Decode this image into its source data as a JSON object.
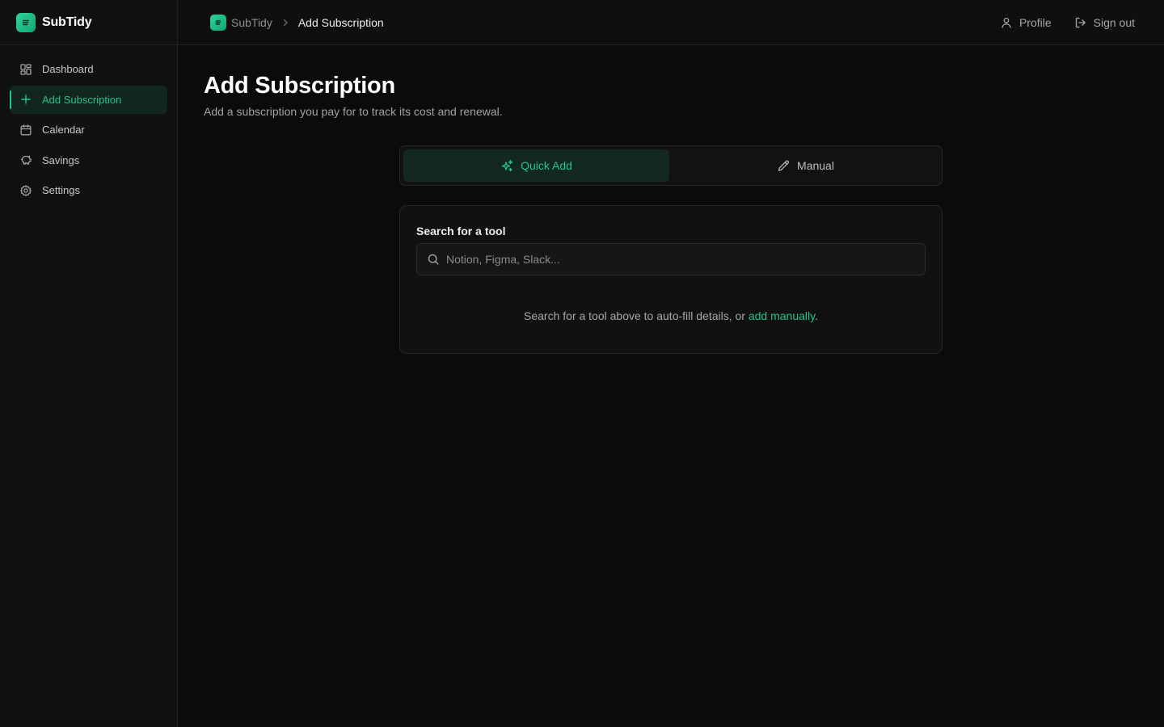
{
  "app": {
    "name": "SubTidy",
    "accent": "#22c58b"
  },
  "sidebar": {
    "items": [
      {
        "label": "Dashboard",
        "icon": "dashboard-icon"
      },
      {
        "label": "Add Subscription",
        "icon": "plus-icon",
        "active": true
      },
      {
        "label": "Calendar",
        "icon": "calendar-icon"
      },
      {
        "label": "Savings",
        "icon": "piggy-bank-icon"
      },
      {
        "label": "Settings",
        "icon": "gear-icon"
      }
    ]
  },
  "topbar": {
    "breadcrumb_root": "SubTidy",
    "breadcrumb_current": "Add Subscription",
    "profile_label": "Profile",
    "signout_label": "Sign out"
  },
  "page": {
    "title": "Add Subscription",
    "subtitle": "Add a subscription you pay for to track its cost and renewal."
  },
  "tabs": [
    {
      "label": "Quick Add",
      "icon": "sparkles-icon",
      "active": true
    },
    {
      "label": "Manual",
      "icon": "pencil-icon",
      "active": false
    }
  ],
  "search": {
    "label": "Search for a tool",
    "placeholder": "Notion, Figma, Slack...",
    "value": ""
  },
  "hint": {
    "prefix": "Search for a tool above to auto-fill details, or ",
    "link": "add manually",
    "suffix": "."
  }
}
